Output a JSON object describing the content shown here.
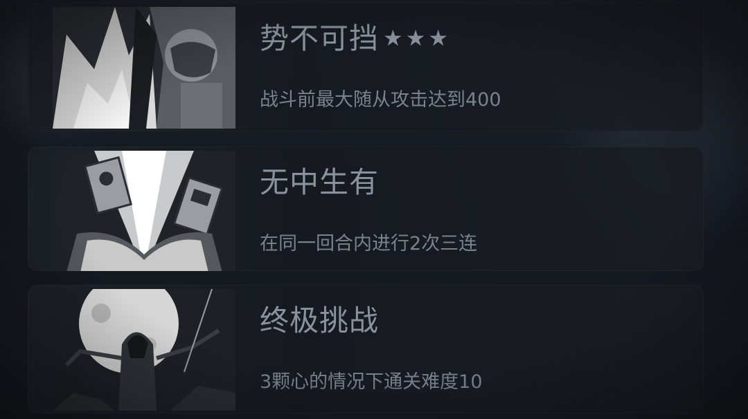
{
  "achievements": [
    {
      "title": "势不可挡",
      "stars": "★★★",
      "description": "战斗前最大随从攻击达到400",
      "art_icon": "warrior-beast-illustration"
    },
    {
      "title": "无中生有",
      "stars": "",
      "description": "在同一回合内进行2次三连",
      "art_icon": "glowing-book-cards-illustration"
    },
    {
      "title": "终极挑战",
      "stars": "",
      "description": "3颗心的情况下通关难度10",
      "art_icon": "hooded-figure-moon-illustration"
    }
  ],
  "colors": {
    "background": "#15191e",
    "card": "#1e232a",
    "title_text": "#8a939d",
    "desc_text": "#7a838d"
  }
}
